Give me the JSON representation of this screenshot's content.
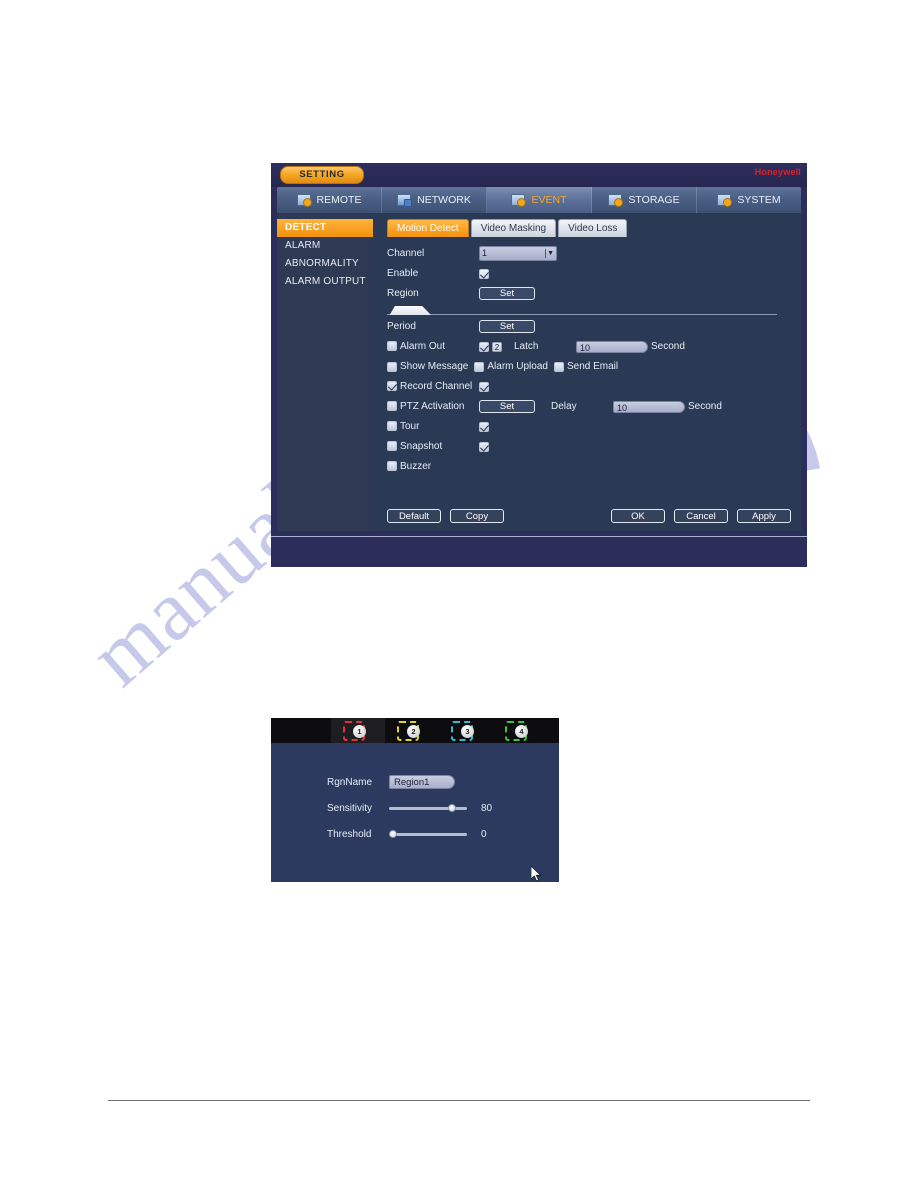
{
  "window": {
    "title_pill": "SETTING",
    "brand": "Honeywell"
  },
  "top_tabs": [
    {
      "label": "REMOTE",
      "icon": "camera-gear-icon",
      "active": false
    },
    {
      "label": "NETWORK",
      "icon": "network-icon",
      "active": false
    },
    {
      "label": "EVENT",
      "icon": "event-gear-icon",
      "active": true
    },
    {
      "label": "STORAGE",
      "icon": "storage-gear-icon",
      "active": false
    },
    {
      "label": "SYSTEM",
      "icon": "system-gear-icon",
      "active": false
    }
  ],
  "sidebar": {
    "items": [
      {
        "label": "DETECT",
        "active": true
      },
      {
        "label": "ALARM",
        "active": false
      },
      {
        "label": "ABNORMALITY",
        "active": false
      },
      {
        "label": "ALARM OUTPUT",
        "active": false
      }
    ]
  },
  "sub_tabs": [
    {
      "label": "Motion Detect",
      "active": true
    },
    {
      "label": "Video Masking",
      "active": false
    },
    {
      "label": "Video Loss",
      "active": false
    }
  ],
  "form": {
    "channel_label": "Channel",
    "channel_value": "1",
    "enable_label": "Enable",
    "enable_checked": true,
    "region_label": "Region",
    "region_button": "Set",
    "period_label": "Period",
    "period_button": "Set",
    "alarm_out_label": "Alarm Out",
    "alarm_out_checked": false,
    "alarm_out_state_checked": true,
    "alarm_out_number": "2",
    "latch_label": "Latch",
    "latch_value": "10",
    "latch_unit": "Second",
    "show_message_label": "Show Message",
    "show_message_checked": false,
    "alarm_upload_label": "Alarm Upload",
    "alarm_upload_checked": false,
    "send_email_label": "Send Email",
    "send_email_checked": false,
    "record_channel_label": "Record Channel",
    "record_channel_checked": true,
    "record_channel_state_checked": true,
    "ptz_activation_label": "PTZ Activation",
    "ptz_activation_checked": false,
    "ptz_button": "Set",
    "delay_label": "Delay",
    "delay_value": "10",
    "delay_unit": "Second",
    "tour_label": "Tour",
    "tour_checked": false,
    "tour_state_checked": true,
    "snapshot_label": "Snapshot",
    "snapshot_checked": false,
    "snapshot_state_checked": true,
    "buzzer_label": "Buzzer",
    "buzzer_checked": false
  },
  "footer_buttons": {
    "default": "Default",
    "copy": "Copy",
    "ok": "OK",
    "cancel": "Cancel",
    "apply": "Apply"
  },
  "region_dialog": {
    "tabs": [
      {
        "number": "1",
        "color": "#e2333c",
        "selected": true
      },
      {
        "number": "2",
        "color": "#e0d32a",
        "selected": false
      },
      {
        "number": "3",
        "color": "#2fbcd4",
        "selected": false
      },
      {
        "number": "4",
        "color": "#3fc43f",
        "selected": false
      }
    ],
    "rgnname_label": "RgnName",
    "rgnname_value": "Region1",
    "sensitivity_label": "Sensitivity",
    "sensitivity_value": "80",
    "sensitivity_percent": 80,
    "threshold_label": "Threshold",
    "threshold_value": "0",
    "threshold_percent": 0
  },
  "watermark": {
    "text": "manualshive.com"
  },
  "colors": {
    "accent_orange": "#f2920c",
    "panel_navy": "#2b3a54",
    "window_navy": "#2d2d5c",
    "brand_red": "#d91f2b"
  }
}
